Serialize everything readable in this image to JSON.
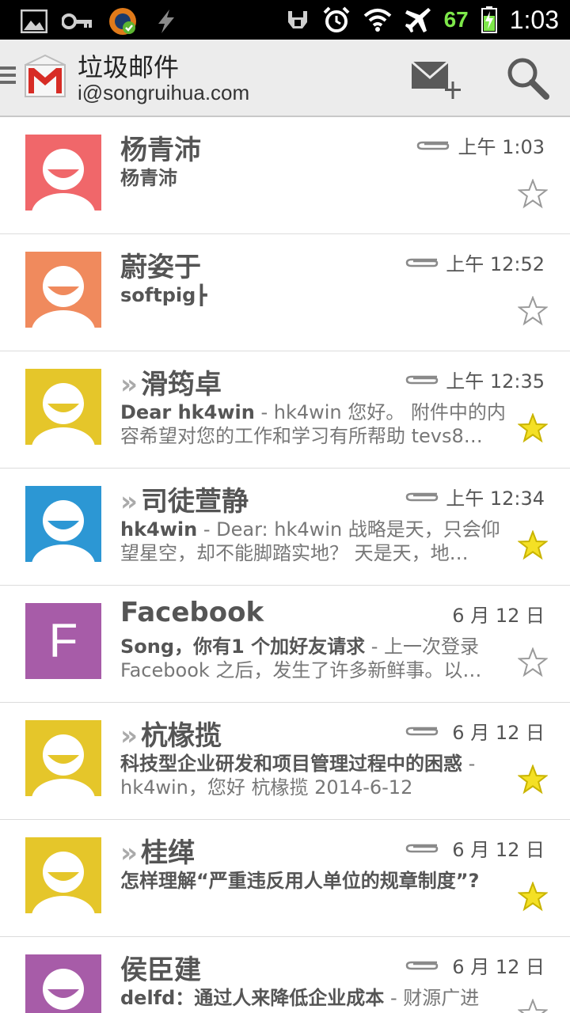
{
  "statusbar": {
    "battery": "67",
    "clock": "1:03"
  },
  "actionbar": {
    "title": "垃圾邮件",
    "account": "i@songruihua.com"
  },
  "colors": {
    "red": "#f0676a",
    "orange": "#f08a5d",
    "yellow": "#e5c62a",
    "blue": "#2c97d4",
    "purple": "#a75ca8",
    "star_on": "#f4e025",
    "star_off": "#9a9a9a"
  },
  "emails": [
    {
      "sender": "杨青沛",
      "forwarded": false,
      "time": "上午 1:03",
      "subject": "杨青沛",
      "preview": "",
      "attachment": true,
      "starred": false,
      "avatar": "red",
      "letter": ""
    },
    {
      "sender": "蔚姿于",
      "forwarded": false,
      "time": "上午 12:52",
      "subject": "softpig┣",
      "preview": "",
      "attachment": true,
      "starred": false,
      "avatar": "orange",
      "letter": ""
    },
    {
      "sender": "滑筠卓",
      "forwarded": true,
      "time": "上午 12:35",
      "subject": "Dear  hk4win",
      "preview": " - hk4win 您好。 附件中的内容希望对您的工作和学习有所帮助 tevs8…",
      "attachment": true,
      "starred": true,
      "avatar": "yellow",
      "letter": ""
    },
    {
      "sender": "司徒萱静",
      "forwarded": true,
      "time": "上午 12:34",
      "subject": "hk4win",
      "preview": " - Dear: hk4win 战略是天，只会仰望星空，却不能脚踏实地？ 天是天，地…",
      "attachment": true,
      "starred": true,
      "avatar": "blue",
      "letter": ""
    },
    {
      "sender": "Facebook",
      "forwarded": false,
      "time": "6 月 12 日",
      "subject": "Song，你有1 个加好友请求",
      "preview": " - 上一次登录 Facebook 之后，发生了许多新鲜事。以…",
      "attachment": false,
      "starred": false,
      "avatar": "purple",
      "letter": "F"
    },
    {
      "sender": "杭椽揽",
      "forwarded": true,
      "time": "6 月 12 日",
      "subject": "科技型企业研发和项目管理过程中的困惑",
      "preview": " - hk4win，您好 杭椽揽 2014-6-12",
      "attachment": true,
      "starred": true,
      "avatar": "yellow",
      "letter": ""
    },
    {
      "sender": "桂缂",
      "forwarded": true,
      "time": "6 月 12 日",
      "subject": "怎样理解“严重违反用人单位的规章制度”?",
      "preview": "",
      "attachment": true,
      "starred": true,
      "avatar": "yellow",
      "letter": ""
    },
    {
      "sender": "侯臣建",
      "forwarded": false,
      "time": "6 月 12 日",
      "subject": "delfd：通过人来降低企业成本",
      "preview": " - 财源广进",
      "attachment": true,
      "starred": false,
      "avatar": "purple",
      "letter": ""
    }
  ]
}
